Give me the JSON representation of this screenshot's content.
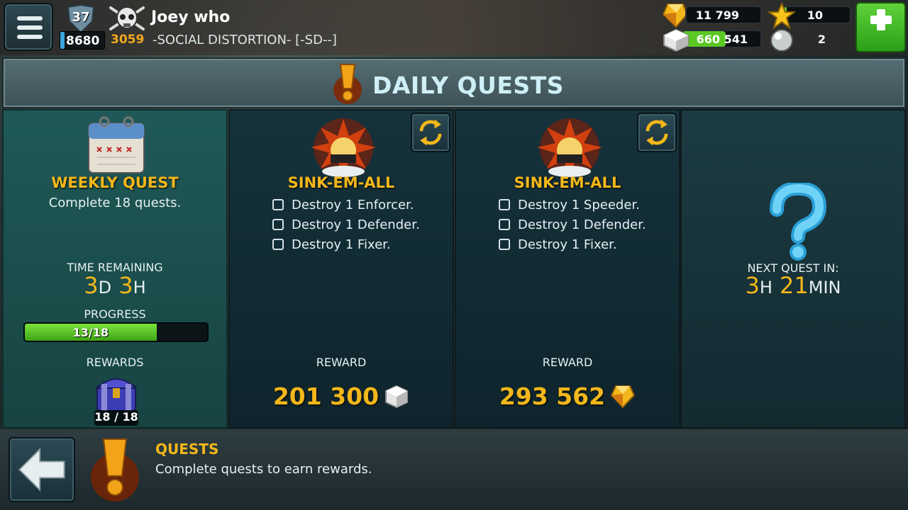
{
  "header": {
    "level": "37",
    "xp": "8680",
    "xp_progress": 0.1,
    "trophies": "3059",
    "player_name": "Joey who",
    "clan": "-SOCIAL DISTORTION- [-SD--]",
    "gold": "11 799",
    "stars": "10",
    "stars_progress": 0.03,
    "silver": "660 541",
    "silver_progress": 0.55,
    "pearls": "2"
  },
  "title": "DAILY QUESTS",
  "weekly": {
    "title": "WEEKLY QUEST",
    "desc": "Complete 18 quests.",
    "time_label": "TIME REMAINING",
    "time_days": "3",
    "time_days_unit": "D",
    "time_hours": "3",
    "time_hours_unit": "H",
    "progress_label": "PROGRESS",
    "progress_text": "13/18",
    "progress_value": 0.722,
    "rewards_label": "REWARDS",
    "chest_count": "18 / 18"
  },
  "quests": [
    {
      "title": "SINK-EM-ALL",
      "tasks": [
        "Destroy 1 Enforcer.",
        "Destroy 1 Defender.",
        "Destroy 1 Fixer."
      ],
      "reward_label": "REWARD",
      "reward_value": "201 300",
      "reward_icon": "silver-cube-icon"
    },
    {
      "title": "SINK-EM-ALL",
      "tasks": [
        "Destroy 1 Speeder.",
        "Destroy 1 Defender.",
        "Destroy 1 Fixer."
      ],
      "reward_label": "REWARD",
      "reward_value": "293 562",
      "reward_icon": "gold-gem-icon"
    }
  ],
  "next": {
    "label": "NEXT QUEST IN:",
    "hours": "3",
    "hours_unit": "H",
    "minutes": "21",
    "minutes_unit": "MIN"
  },
  "footer": {
    "title": "QUESTS",
    "desc": "Complete quests to earn rewards."
  },
  "colors": {
    "accent_yellow": "#f3b71b",
    "progress_green": "#5bc824",
    "title_text": "#cfeff6"
  }
}
